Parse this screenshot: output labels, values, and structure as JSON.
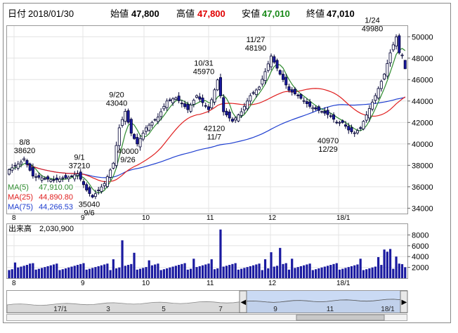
{
  "header": {
    "date_label": "日付",
    "date_value": "2018/01/30",
    "open_label": "始値",
    "open_value": "47,800",
    "high_label": "高値",
    "high_value": "47,800",
    "low_label": "安値",
    "low_value": "47,010",
    "close_label": "終値",
    "close_value": "47,010"
  },
  "colors": {
    "up": "#ffffff",
    "down": "#1a1aa0",
    "candle_outline": "#000033",
    "ma5": "#2e8b2e",
    "ma25": "#e02020",
    "ma75": "#1f3fd0",
    "high_value": "#e00000",
    "low_value": "#1a8a1a",
    "volume": "#1a1aa0",
    "navigator_fill": "#b8cdf0"
  },
  "chart_data": [
    {
      "type": "candlestick",
      "ylim": [
        33500,
        51000
      ],
      "y_ticks": [
        "50000",
        "48000",
        "46000",
        "44000",
        "42000",
        "40000",
        "38000",
        "36000",
        "34000"
      ],
      "x_ticks": [
        "8",
        "9",
        "10",
        "11",
        "12",
        "18/1"
      ],
      "legend": [
        {
          "label": "MA(5)",
          "value": "47,910.00",
          "color": "ma5"
        },
        {
          "label": "MA(25)",
          "value": "44,890.80",
          "color": "ma25"
        },
        {
          "label": "MA(75)",
          "value": "44,266.53",
          "color": "ma75"
        }
      ],
      "annotations": [
        {
          "date": "8/8",
          "value": "38620",
          "pos": "above"
        },
        {
          "date": "9/1",
          "value": "37210",
          "pos": "above"
        },
        {
          "date": "9/6",
          "value": "35040",
          "pos": "below"
        },
        {
          "date": "9/20",
          "value": "43040",
          "pos": "above"
        },
        {
          "date": "9/26",
          "value": "40000",
          "pos": "below"
        },
        {
          "date": "10/31",
          "value": "45970",
          "pos": "above"
        },
        {
          "date": "11/7",
          "value": "42120",
          "pos": "below"
        },
        {
          "date": "11/27",
          "value": "48190",
          "pos": "above"
        },
        {
          "date": "12/29",
          "value": "40970",
          "pos": "below"
        },
        {
          "date": "1/24",
          "value": "49980",
          "pos": "above"
        }
      ]
    },
    {
      "type": "bar",
      "title": "出来高",
      "title_value": "2,030,900",
      "ylim": [
        0,
        10000
      ],
      "y_ticks": [
        "8000",
        "6000",
        "4000",
        "2000"
      ],
      "x_ticks": [
        "8",
        "9",
        "10",
        "11",
        "12",
        "18/1"
      ]
    },
    {
      "type": "area",
      "x_ticks": [
        "17/1",
        "3",
        "5",
        "7",
        "9",
        "11",
        "18/1"
      ]
    }
  ]
}
